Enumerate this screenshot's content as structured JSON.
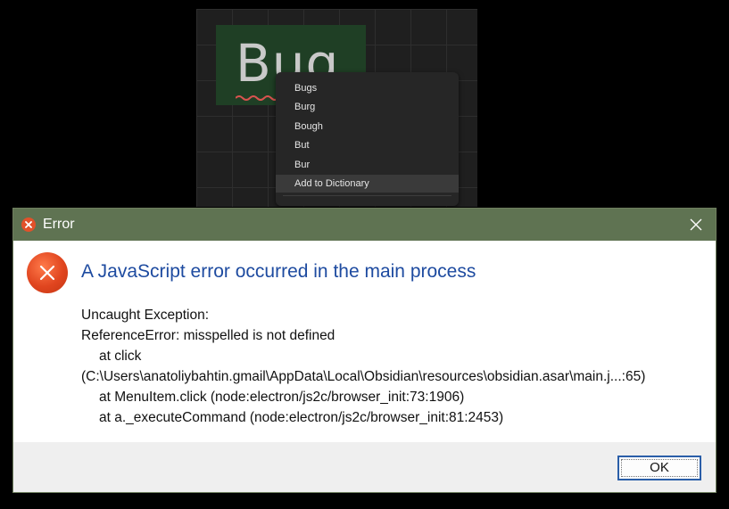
{
  "background_app": {
    "note_word": "Bug",
    "context_menu": {
      "items": [
        "Bugs",
        "Burg",
        "Bough",
        "But",
        "Bur",
        "Add to Dictionary"
      ],
      "highlighted_index": 5
    }
  },
  "dialog": {
    "title": "Error",
    "heading": "A JavaScript error occurred in the main process",
    "message_lines": [
      "Uncaught Exception:",
      "ReferenceError: misspelled is not defined",
      "at click",
      "(C:\\Users\\anatoliybahtin.gmail\\AppData\\Local\\Obsidian\\resources\\obsidian.asar\\main.j...:65)",
      "at MenuItem.click (node:electron/js2c/browser_init:73:1906)",
      "at a._executeCommand (node:electron/js2c/browser_init:81:2453)"
    ],
    "ok_label": "OK"
  },
  "colors": {
    "titlebar": "#5f7352",
    "heading": "#1e4ba0",
    "error_icon": "#e0451f"
  }
}
